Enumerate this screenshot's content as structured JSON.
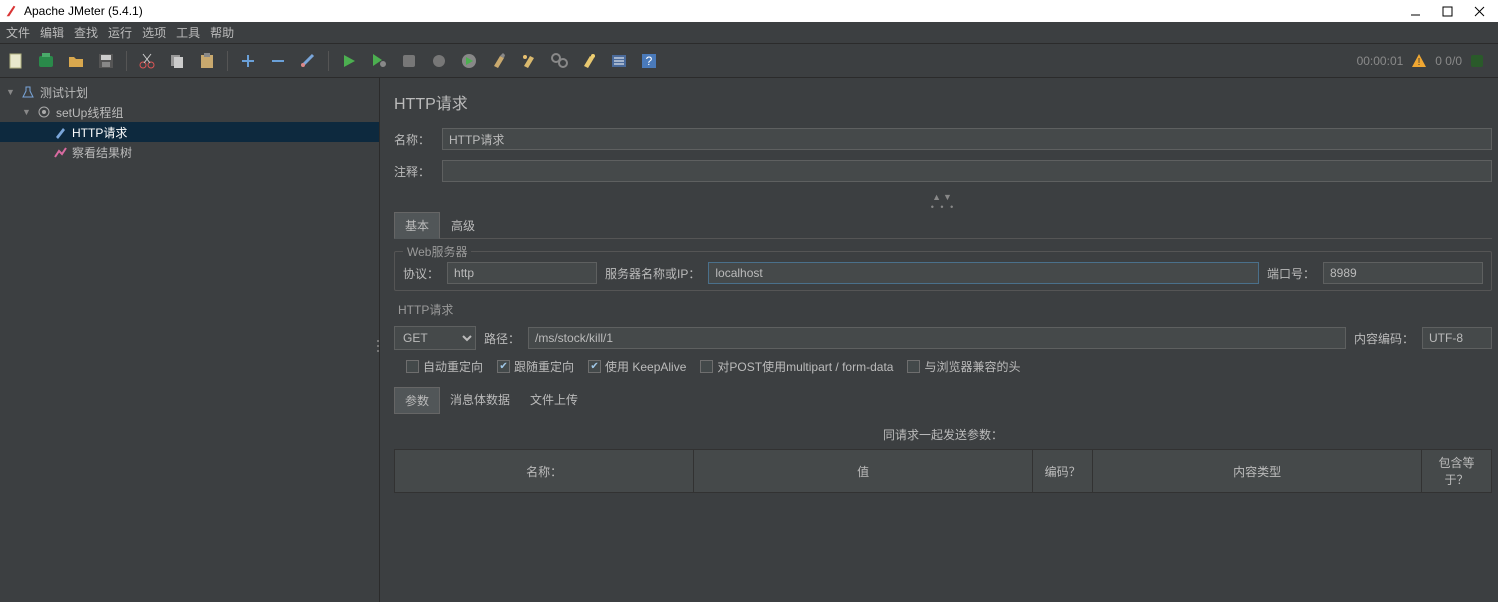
{
  "window": {
    "title": "Apache JMeter (5.4.1)"
  },
  "menu": [
    "文件",
    "编辑",
    "查找",
    "运行",
    "选项",
    "工具",
    "帮助"
  ],
  "status": {
    "time": "00:00:01",
    "counts": "0   0/0"
  },
  "tree": {
    "root": "测试计划",
    "group": "setUp线程组",
    "http": "HTTP请求",
    "results": "察看结果树"
  },
  "editor": {
    "title": "HTTP请求",
    "name_label": "名称：",
    "name_value": "HTTP请求",
    "comment_label": "注释：",
    "comment_value": "",
    "tab_basic": "基本",
    "tab_advanced": "高级",
    "web_server_label": "Web服务器",
    "protocol_label": "协议：",
    "protocol_value": "http",
    "server_label": "服务器名称或IP：",
    "server_value": "localhost",
    "port_label": "端口号：",
    "port_value": "8989",
    "http_request_label": "HTTP请求",
    "method_value": "GET",
    "path_label": "路径：",
    "path_value": "/ms/stock/kill/1",
    "encoding_label": "内容编码：",
    "encoding_value": "UTF-8",
    "chk_auto_redirect": "自动重定向",
    "chk_follow_redirect": "跟随重定向",
    "chk_keepalive": "使用 KeepAlive",
    "chk_multipart": "对POST使用multipart / form-data",
    "chk_browser_headers": "与浏览器兼容的头",
    "subtab_params": "参数",
    "subtab_body": "消息体数据",
    "subtab_upload": "文件上传",
    "params_title": "同请求一起发送参数：",
    "col_name": "名称：",
    "col_value": "值",
    "col_encode": "编码？",
    "col_ctype": "内容类型",
    "col_include": "包含等于？"
  }
}
